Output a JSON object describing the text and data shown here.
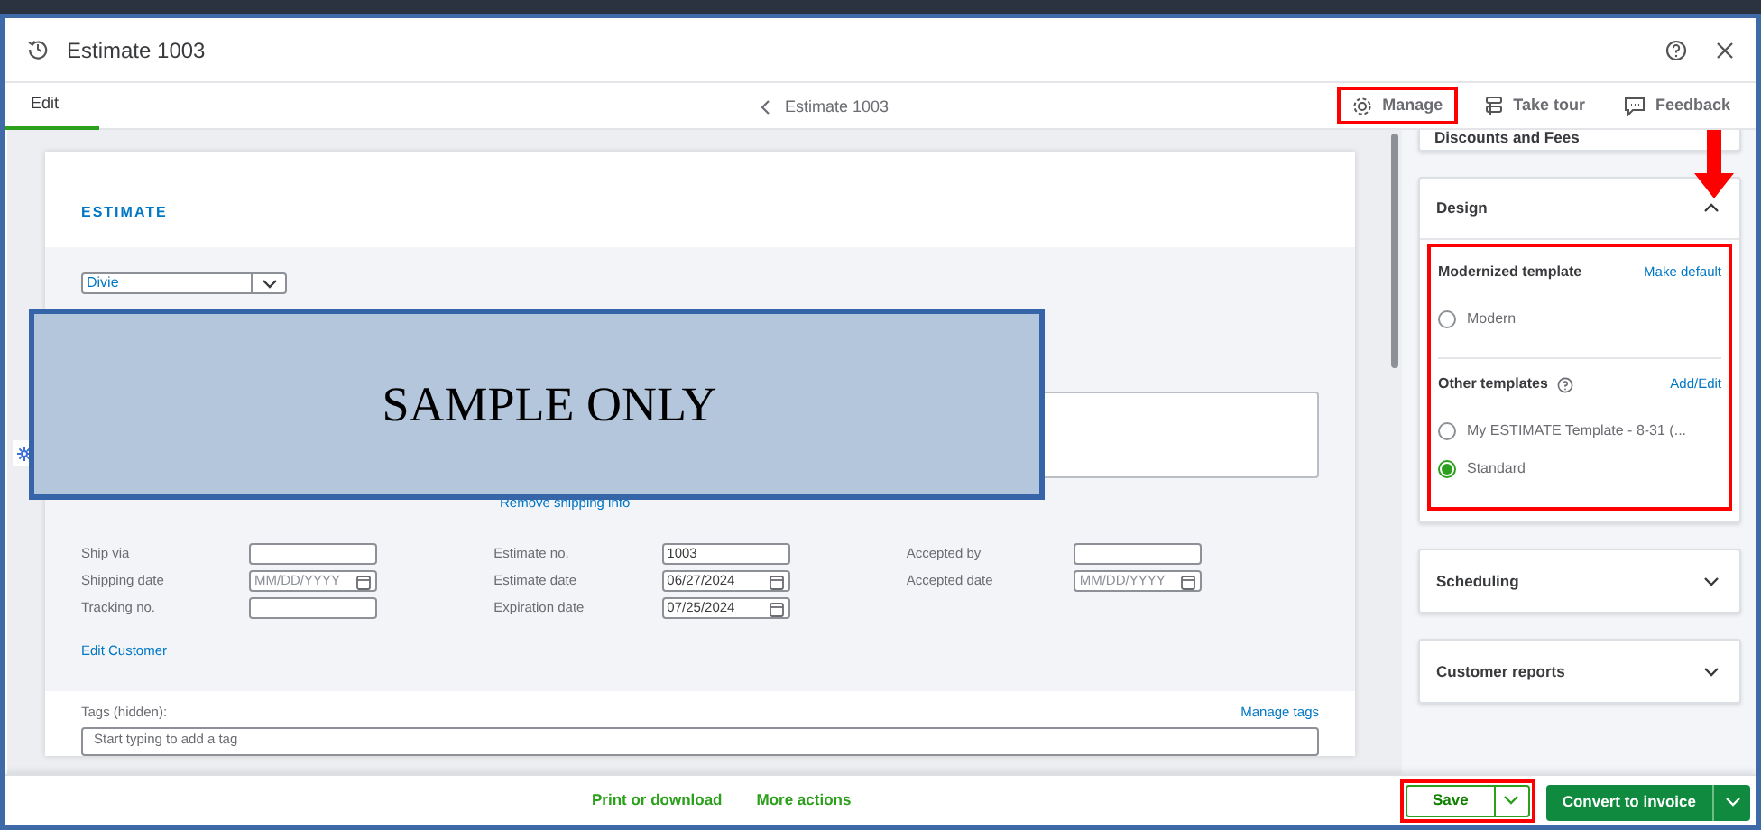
{
  "window": {
    "title": "Estimate 1003"
  },
  "tabs": [
    {
      "label": "Edit",
      "selected": true
    }
  ],
  "breadcrumb": {
    "label": "Estimate 1003"
  },
  "toolbar": [
    {
      "kind": "gear",
      "label": "Manage",
      "highlighted": true
    },
    {
      "kind": "tour",
      "label": "Take tour",
      "highlighted": false
    },
    {
      "kind": "feedback",
      "label": "Feedback",
      "highlighted": false
    }
  ],
  "estimate": {
    "heading": "ESTIMATE",
    "customer": "Divie",
    "overlay_text": "SAMPLE ONLY",
    "remove_shipping": "Remove shipping info",
    "field_columns": [
      [
        {
          "label": "Ship via",
          "kind": "text"
        },
        {
          "label": "Shipping date",
          "kind": "date",
          "placeholder": "MM/DD/YYYY"
        },
        {
          "label": "Tracking no.",
          "kind": "text"
        }
      ],
      [
        {
          "label": "Estimate no.",
          "kind": "text",
          "value": "1003"
        },
        {
          "label": "Estimate date",
          "kind": "date",
          "value": "06/27/2024"
        },
        {
          "label": "Expiration date",
          "kind": "date",
          "value": "07/25/2024"
        }
      ],
      [
        {
          "label": "Accepted by",
          "kind": "text"
        },
        {
          "label": "Accepted date",
          "kind": "date",
          "placeholder": "MM/DD/YYYY"
        }
      ]
    ],
    "edit_customer": "Edit Customer",
    "tags_label": "Tags (hidden):",
    "manage_tags": "Manage tags",
    "tags_placeholder": "Start typing to add a tag"
  },
  "side_panel": [
    {
      "title": "Discounts and Fees",
      "kind": "clipped"
    },
    {
      "title": "Design",
      "kind": "section",
      "expanded": true,
      "highlighted": true,
      "groups": [
        {
          "title": "Modernized template",
          "action": "Make default",
          "options": [
            {
              "label": "Modern",
              "selected": false
            }
          ]
        },
        {
          "title": "Other templates",
          "help": true,
          "action": "Add/Edit",
          "options": [
            {
              "label": "My ESTIMATE Template - 8-31 (...",
              "selected": false
            },
            {
              "label": "Standard",
              "selected": true
            }
          ]
        }
      ]
    },
    {
      "title": "Scheduling",
      "kind": "section",
      "expanded": false
    },
    {
      "title": "Customer reports",
      "kind": "section",
      "expanded": false
    }
  ],
  "footer": {
    "links": [
      "Print or download",
      "More actions"
    ],
    "save": {
      "label": "Save",
      "highlighted": true
    },
    "convert": {
      "label": "Convert to invoice"
    }
  },
  "annotations": {
    "arrow": true
  }
}
